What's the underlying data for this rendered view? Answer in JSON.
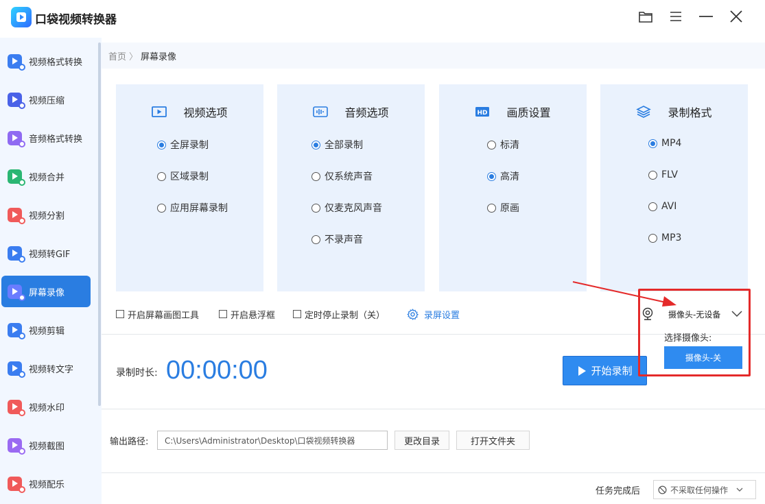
{
  "app": {
    "title": "口袋视频转换器"
  },
  "sidebar": {
    "items": [
      {
        "label": "视频格式转换",
        "color": "#3b7df0"
      },
      {
        "label": "视频压缩",
        "color": "#4a62e8"
      },
      {
        "label": "音频格式转换",
        "color": "#8f6af2"
      },
      {
        "label": "视频合并",
        "color": "#2bb673"
      },
      {
        "label": "视频分割",
        "color": "#f05a5a"
      },
      {
        "label": "视频转GIF",
        "color": "#3b7df0"
      },
      {
        "label": "屏幕录像",
        "color": "#6a7cff",
        "active": true
      },
      {
        "label": "视频剪辑",
        "color": "#3b7df0"
      },
      {
        "label": "视频转文字",
        "color": "#3b7df0"
      },
      {
        "label": "视频水印",
        "color": "#f05a5a"
      },
      {
        "label": "视频截图",
        "color": "#9a6af2"
      },
      {
        "label": "视频配乐",
        "color": "#f05a5a"
      }
    ]
  },
  "breadcrumb": {
    "home": "首页",
    "separator": "〉",
    "current": "屏幕录像"
  },
  "cards": [
    {
      "title": "视频选项",
      "icon": "video-play-icon",
      "options": [
        "全屏录制",
        "区域录制",
        "应用屏幕录制"
      ],
      "selected": 0
    },
    {
      "title": "音频选项",
      "icon": "audio-wave-icon",
      "options": [
        "全部录制",
        "仅系统声音",
        "仅麦克风声音",
        "不录声音"
      ],
      "selected": 0
    },
    {
      "title": "画质设置",
      "icon": "hd-icon",
      "options": [
        "标清",
        "高清",
        "原画"
      ],
      "selected": 1
    },
    {
      "title": "录制格式",
      "icon": "layers-icon",
      "options": [
        "MP4",
        "FLV",
        "AVI",
        "MP3"
      ],
      "selected": 0
    }
  ],
  "tools": {
    "drawing_tool": "开启屏幕画图工具",
    "floating_window": "开启悬浮框",
    "timed_stop": "定时停止录制（关）",
    "record_settings": "录屏设置"
  },
  "camera": {
    "select_value": "摄像头-无设备",
    "panel_label": "选择摄像头:",
    "off_button": "摄像头-关"
  },
  "recording": {
    "duration_label": "录制时长:",
    "duration_value": "00:00:00",
    "start_button": "开始录制"
  },
  "output": {
    "label": "输出路径:",
    "path": "C:\\Users\\Administrator\\Desktop\\口袋视频转换器",
    "change_dir": "更改目录",
    "open_folder": "打开文件夹"
  },
  "after_task": {
    "label": "任务完成后",
    "value": "不采取任何操作"
  },
  "colors": {
    "accent": "#2a7de1",
    "annotation_red": "#e42a2a",
    "card_bg": "#eaf2fd"
  }
}
